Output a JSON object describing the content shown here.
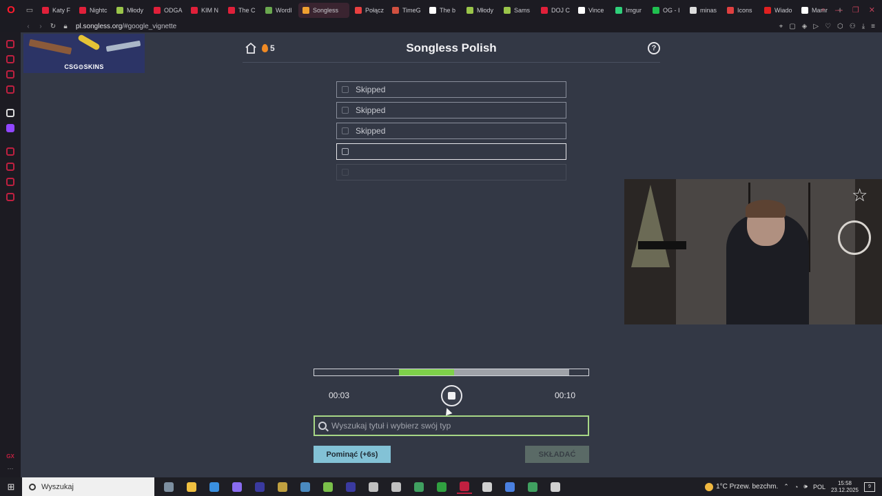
{
  "browser": {
    "tabs": [
      {
        "label": "Katy F",
        "color": "#e0203a"
      },
      {
        "label": "Nightc",
        "color": "#e0203a"
      },
      {
        "label": "Młody",
        "color": "#9ac54a"
      },
      {
        "label": "ODGA",
        "color": "#e0203a"
      },
      {
        "label": "KIM N",
        "color": "#e0203a"
      },
      {
        "label": "The C",
        "color": "#e0203a"
      },
      {
        "label": "Wordl",
        "color": "#6aa84f"
      },
      {
        "label": "Songless",
        "color": "#f0a030"
      },
      {
        "label": "Połącz",
        "color": "#e84040"
      },
      {
        "label": "TimeG",
        "color": "#d05040"
      },
      {
        "label": "The b",
        "color": "#ffffff"
      },
      {
        "label": "Młody",
        "color": "#9ac54a"
      },
      {
        "label": "Sams",
        "color": "#9ac54a"
      },
      {
        "label": "DOJ C",
        "color": "#e0203a"
      },
      {
        "label": "Vince",
        "color": "#ffffff"
      },
      {
        "label": "Imgur",
        "color": "#2fd07a"
      },
      {
        "label": "OG - I",
        "color": "#20c050"
      },
      {
        "label": "minas",
        "color": "#dddddd"
      },
      {
        "label": "Icons",
        "color": "#e04040"
      },
      {
        "label": "Wiado",
        "color": "#e02020"
      },
      {
        "label": "Mamr",
        "color": "#ffffff"
      }
    ],
    "active_tab_index": 7,
    "url_host": "pl.songless.org",
    "url_path": "/#google_vignette",
    "new_tab": "+"
  },
  "ad": {
    "brand": "CSG⊙SKINS"
  },
  "game": {
    "title": "Songless Polish",
    "streak": "5",
    "help": "?",
    "guesses": [
      {
        "label": "Skipped",
        "state": "skipped"
      },
      {
        "label": "Skipped",
        "state": "skipped"
      },
      {
        "label": "Skipped",
        "state": "skipped"
      },
      {
        "label": "",
        "state": "current"
      },
      {
        "label": "",
        "state": "empty"
      }
    ],
    "player": {
      "time_current": "00:03",
      "time_total": "00:10",
      "progress_segments": [
        {
          "from": 0.0,
          "to": 0.31,
          "color": "#333845"
        },
        {
          "from": 0.31,
          "to": 0.51,
          "color": "#7ed04a"
        },
        {
          "from": 0.51,
          "to": 0.93,
          "color": "#9fa2a8"
        },
        {
          "from": 0.93,
          "to": 1.0,
          "color": "#333845"
        }
      ]
    },
    "search_placeholder": "Wyszukaj tytuł i wybierz swój typ",
    "skip_label": "Pominąć (+6s)",
    "submit_label": "SKŁADAĆ"
  },
  "taskbar": {
    "search_label": "Wyszukaj",
    "apps": [
      "#7d8fa0",
      "#f0c040",
      "#3a90e0",
      "#8a6cf0",
      "#3a3aa0",
      "#c0a040",
      "#4a8ac0",
      "#7ac04a",
      "#3a3aa0",
      "#c0c0c0",
      "#c0c0c0",
      "#40a060",
      "#30a040",
      "#c02040",
      "#d0d0d0",
      "#4a80e0",
      "#40a060",
      "#d0d0d0"
    ],
    "active_app_index": 13,
    "weather": "1°C  Przew. bezchm.",
    "lang": "POL",
    "time": "15:58",
    "date": "23.12.2025",
    "notifications": "9"
  }
}
